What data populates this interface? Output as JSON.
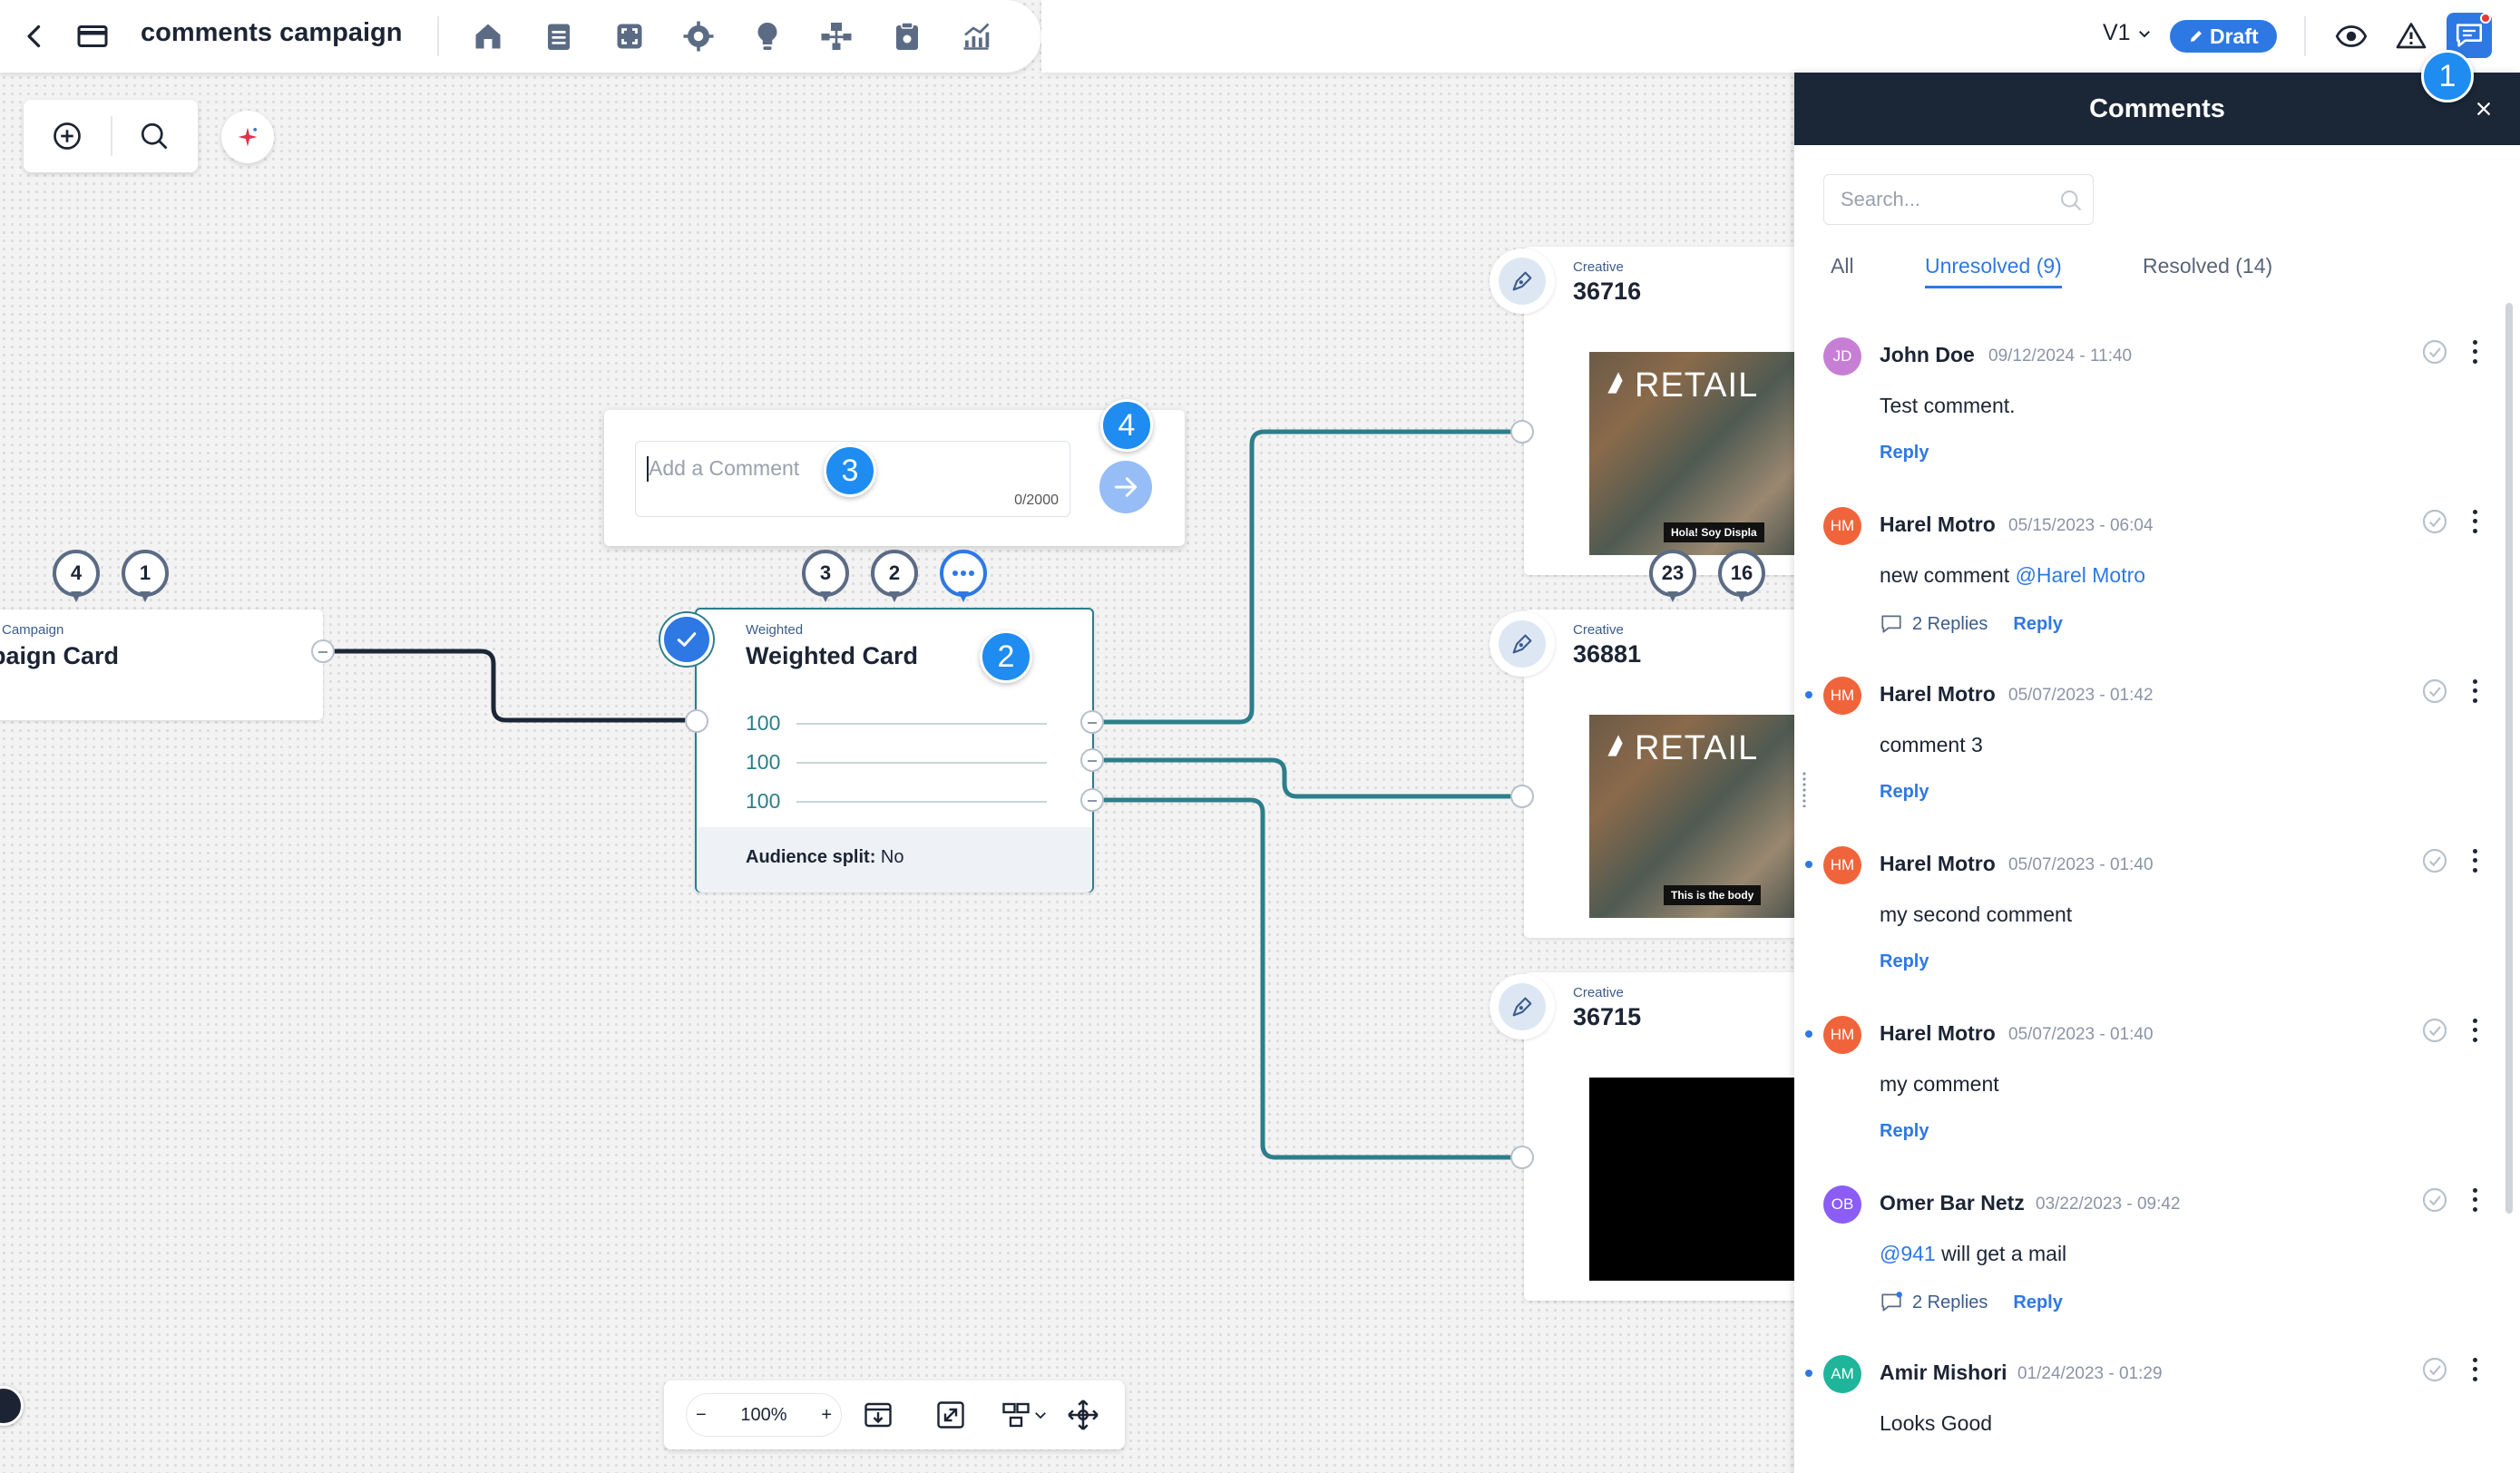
{
  "topbar": {
    "campaign_name": "comments campaign",
    "version": "V1",
    "status": "Draft",
    "icons": [
      "back-icon",
      "campaign-card-icon",
      "home-icon",
      "calendar-icon",
      "frame-icon",
      "target-icon",
      "bulb-icon",
      "flow-icon",
      "clipboard-icon",
      "analytics-icon",
      "eye-icon",
      "warning-icon",
      "chat-icon"
    ]
  },
  "callouts": [
    "1",
    "2",
    "3",
    "4"
  ],
  "canvas": {
    "campaign_card": {
      "type": "Campaign",
      "title": "paign Card",
      "pins": [
        "4",
        "1"
      ]
    },
    "weighted_card": {
      "type": "Weighted",
      "title": "Weighted Card",
      "rows": [
        "100",
        "100",
        "100"
      ],
      "audience_label": "Audience split:",
      "audience_value": "No",
      "pins": [
        "3",
        "2"
      ]
    },
    "composer": {
      "placeholder": "Add a Comment",
      "counter": "0/2000"
    },
    "creatives": [
      {
        "type": "Creative",
        "id": "36716",
        "image_word": "RETAIL",
        "caption": "Hola! Soy Displa",
        "pins": [
          "23",
          "16"
        ]
      },
      {
        "type": "Creative",
        "id": "36881",
        "image_word": "RETAIL",
        "caption": "This is the body"
      },
      {
        "type": "Creative",
        "id": "36715"
      }
    ],
    "zoom": {
      "level": "100%",
      "minus": "−",
      "plus": "+"
    }
  },
  "comments_panel": {
    "title": "Comments",
    "search_placeholder": "Search...",
    "tabs": [
      {
        "label": "All"
      },
      {
        "label": "Unresolved (9)"
      },
      {
        "label": "Resolved (14)"
      }
    ],
    "comments": [
      {
        "initials": "JD",
        "author": "John Doe",
        "time": "09/12/2024 - 11:40",
        "text": "Test comment.",
        "replies": "",
        "reply_label": "Reply",
        "avatar_color": "#c77fd6",
        "unread": false
      },
      {
        "initials": "HM",
        "author": "Harel Motro",
        "time": "05/15/2023 - 06:04",
        "text": "new comment ",
        "mention": "@Harel Motro",
        "replies": "2 Replies",
        "reply_label": "Reply",
        "avatar_color": "#f0643c",
        "unread": false
      },
      {
        "initials": "HM",
        "author": "Harel Motro",
        "time": "05/07/2023 - 01:42",
        "text": "comment 3",
        "replies": "",
        "reply_label": "Reply",
        "avatar_color": "#f0643c",
        "unread": true
      },
      {
        "initials": "HM",
        "author": "Harel Motro",
        "time": "05/07/2023 - 01:40",
        "text": "my second comment",
        "replies": "",
        "reply_label": "Reply",
        "avatar_color": "#f0643c",
        "unread": true
      },
      {
        "initials": "HM",
        "author": "Harel Motro",
        "time": "05/07/2023 - 01:40",
        "text": "my comment",
        "replies": "",
        "reply_label": "Reply",
        "avatar_color": "#f0643c",
        "unread": true
      },
      {
        "initials": "OB",
        "author": "Omer Bar Netz",
        "time": "03/22/2023 - 09:42",
        "mention_first": "@941",
        "text": " will get a mail",
        "replies": "2 Replies",
        "reply_label": "Reply",
        "avatar_color": "#8b5cf6",
        "unread": false
      },
      {
        "initials": "AM",
        "author": "Amir Mishori",
        "time": "01/24/2023 - 01:29",
        "text": "Looks Good",
        "replies": "",
        "reply_label": "",
        "avatar_color": "#1fb59a",
        "unread": true
      }
    ]
  },
  "colors": {
    "accent": "#2e78e4",
    "teal": "#2c7e8a",
    "panel_header": "#1b2637",
    "callout": "#1e8cf0"
  }
}
